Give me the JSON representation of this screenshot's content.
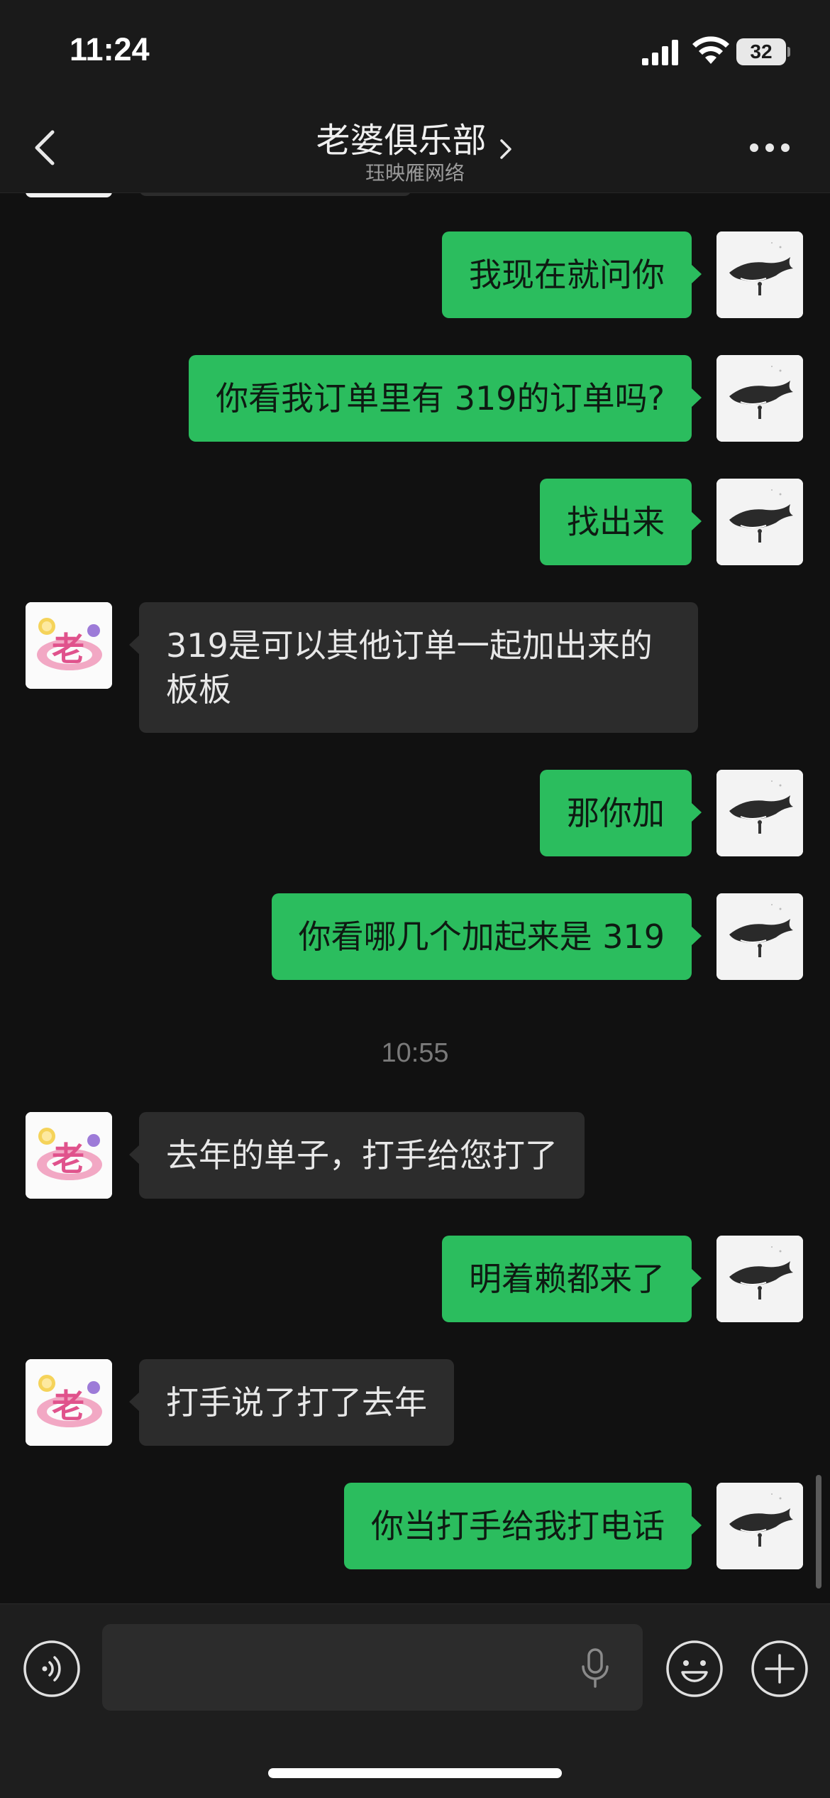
{
  "status_bar": {
    "time": "11:24",
    "battery": "32",
    "icons": [
      "signal-icon",
      "wifi-icon",
      "battery-icon"
    ]
  },
  "header": {
    "title": "老婆俱乐部",
    "subtitle": "珏映雁网络",
    "icons": [
      "back-icon",
      "chevron-right-icon",
      "more-icon"
    ]
  },
  "messages": [
    {
      "sender": "me",
      "text": "我现在就问你"
    },
    {
      "sender": "me",
      "text": "你看我订单里有 319的订单吗?"
    },
    {
      "sender": "me",
      "text": "找出来"
    },
    {
      "sender": "them",
      "text": "319是可以其他订单一起加出来的板板"
    },
    {
      "sender": "me",
      "text": "那你加"
    },
    {
      "sender": "me",
      "text": "你看哪几个加起来是 319"
    },
    {
      "sender": "them",
      "text": "去年的单子，打手给您打了"
    },
    {
      "sender": "me",
      "text": "明着赖都来了"
    },
    {
      "sender": "them",
      "text": "打手说了打了去年"
    },
    {
      "sender": "me",
      "text": "你当打手给我打电话"
    }
  ],
  "timestamp": "10:55",
  "input_bar": {
    "value": "",
    "icons": [
      "voice-icon",
      "mic-icon",
      "emoji-icon",
      "plus-icon"
    ]
  },
  "colors": {
    "my_bubble": "#2bbd5e",
    "their_bubble": "#2c2c2c",
    "background": "#111111"
  }
}
